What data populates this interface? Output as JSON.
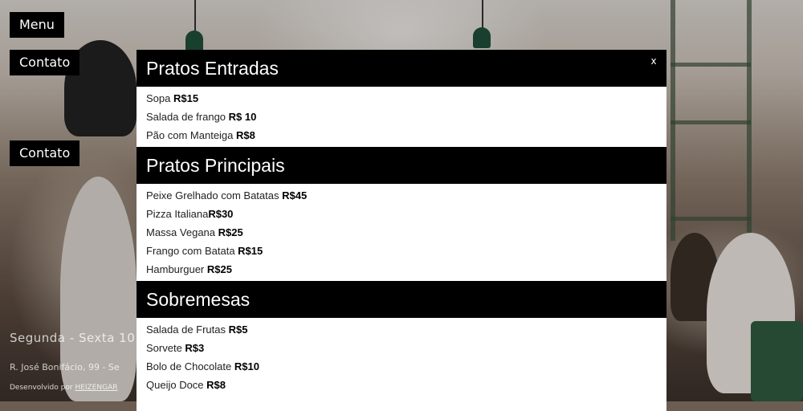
{
  "nav": {
    "menu_label": "Menu",
    "contato_label": "Contato",
    "contato_label_2": "Contato"
  },
  "footer": {
    "hours": "Segunda - Sexta 10",
    "address": "R. José Bonifácio, 99 - Se",
    "developed_prefix": "Desenvolvido por",
    "developer": "HEIZENGAR"
  },
  "modal": {
    "close_label": "x",
    "sections": [
      {
        "title": "Pratos Entradas",
        "items": [
          {
            "name": "Sopa ",
            "price": "R$15"
          },
          {
            "name": "Salada de frango ",
            "price": "R$ 10"
          },
          {
            "name": "Pão com Manteiga ",
            "price": "R$8"
          }
        ]
      },
      {
        "title": "Pratos Principais",
        "items": [
          {
            "name": "Peixe Grelhado com Batatas ",
            "price": "R$45"
          },
          {
            "name": "Pizza Italiana",
            "price": "R$30"
          },
          {
            "name": "Massa Vegana ",
            "price": "R$25"
          },
          {
            "name": "Frango com Batata ",
            "price": "R$15"
          },
          {
            "name": "Hamburguer ",
            "price": "R$25"
          }
        ]
      },
      {
        "title": "Sobremesas",
        "items": [
          {
            "name": "Salada de Frutas ",
            "price": "R$5"
          },
          {
            "name": "Sorvete ",
            "price": "R$3"
          },
          {
            "name": "Bolo de Chocolate ",
            "price": "R$10"
          },
          {
            "name": "Queijo Doce ",
            "price": "R$8"
          }
        ]
      }
    ]
  }
}
